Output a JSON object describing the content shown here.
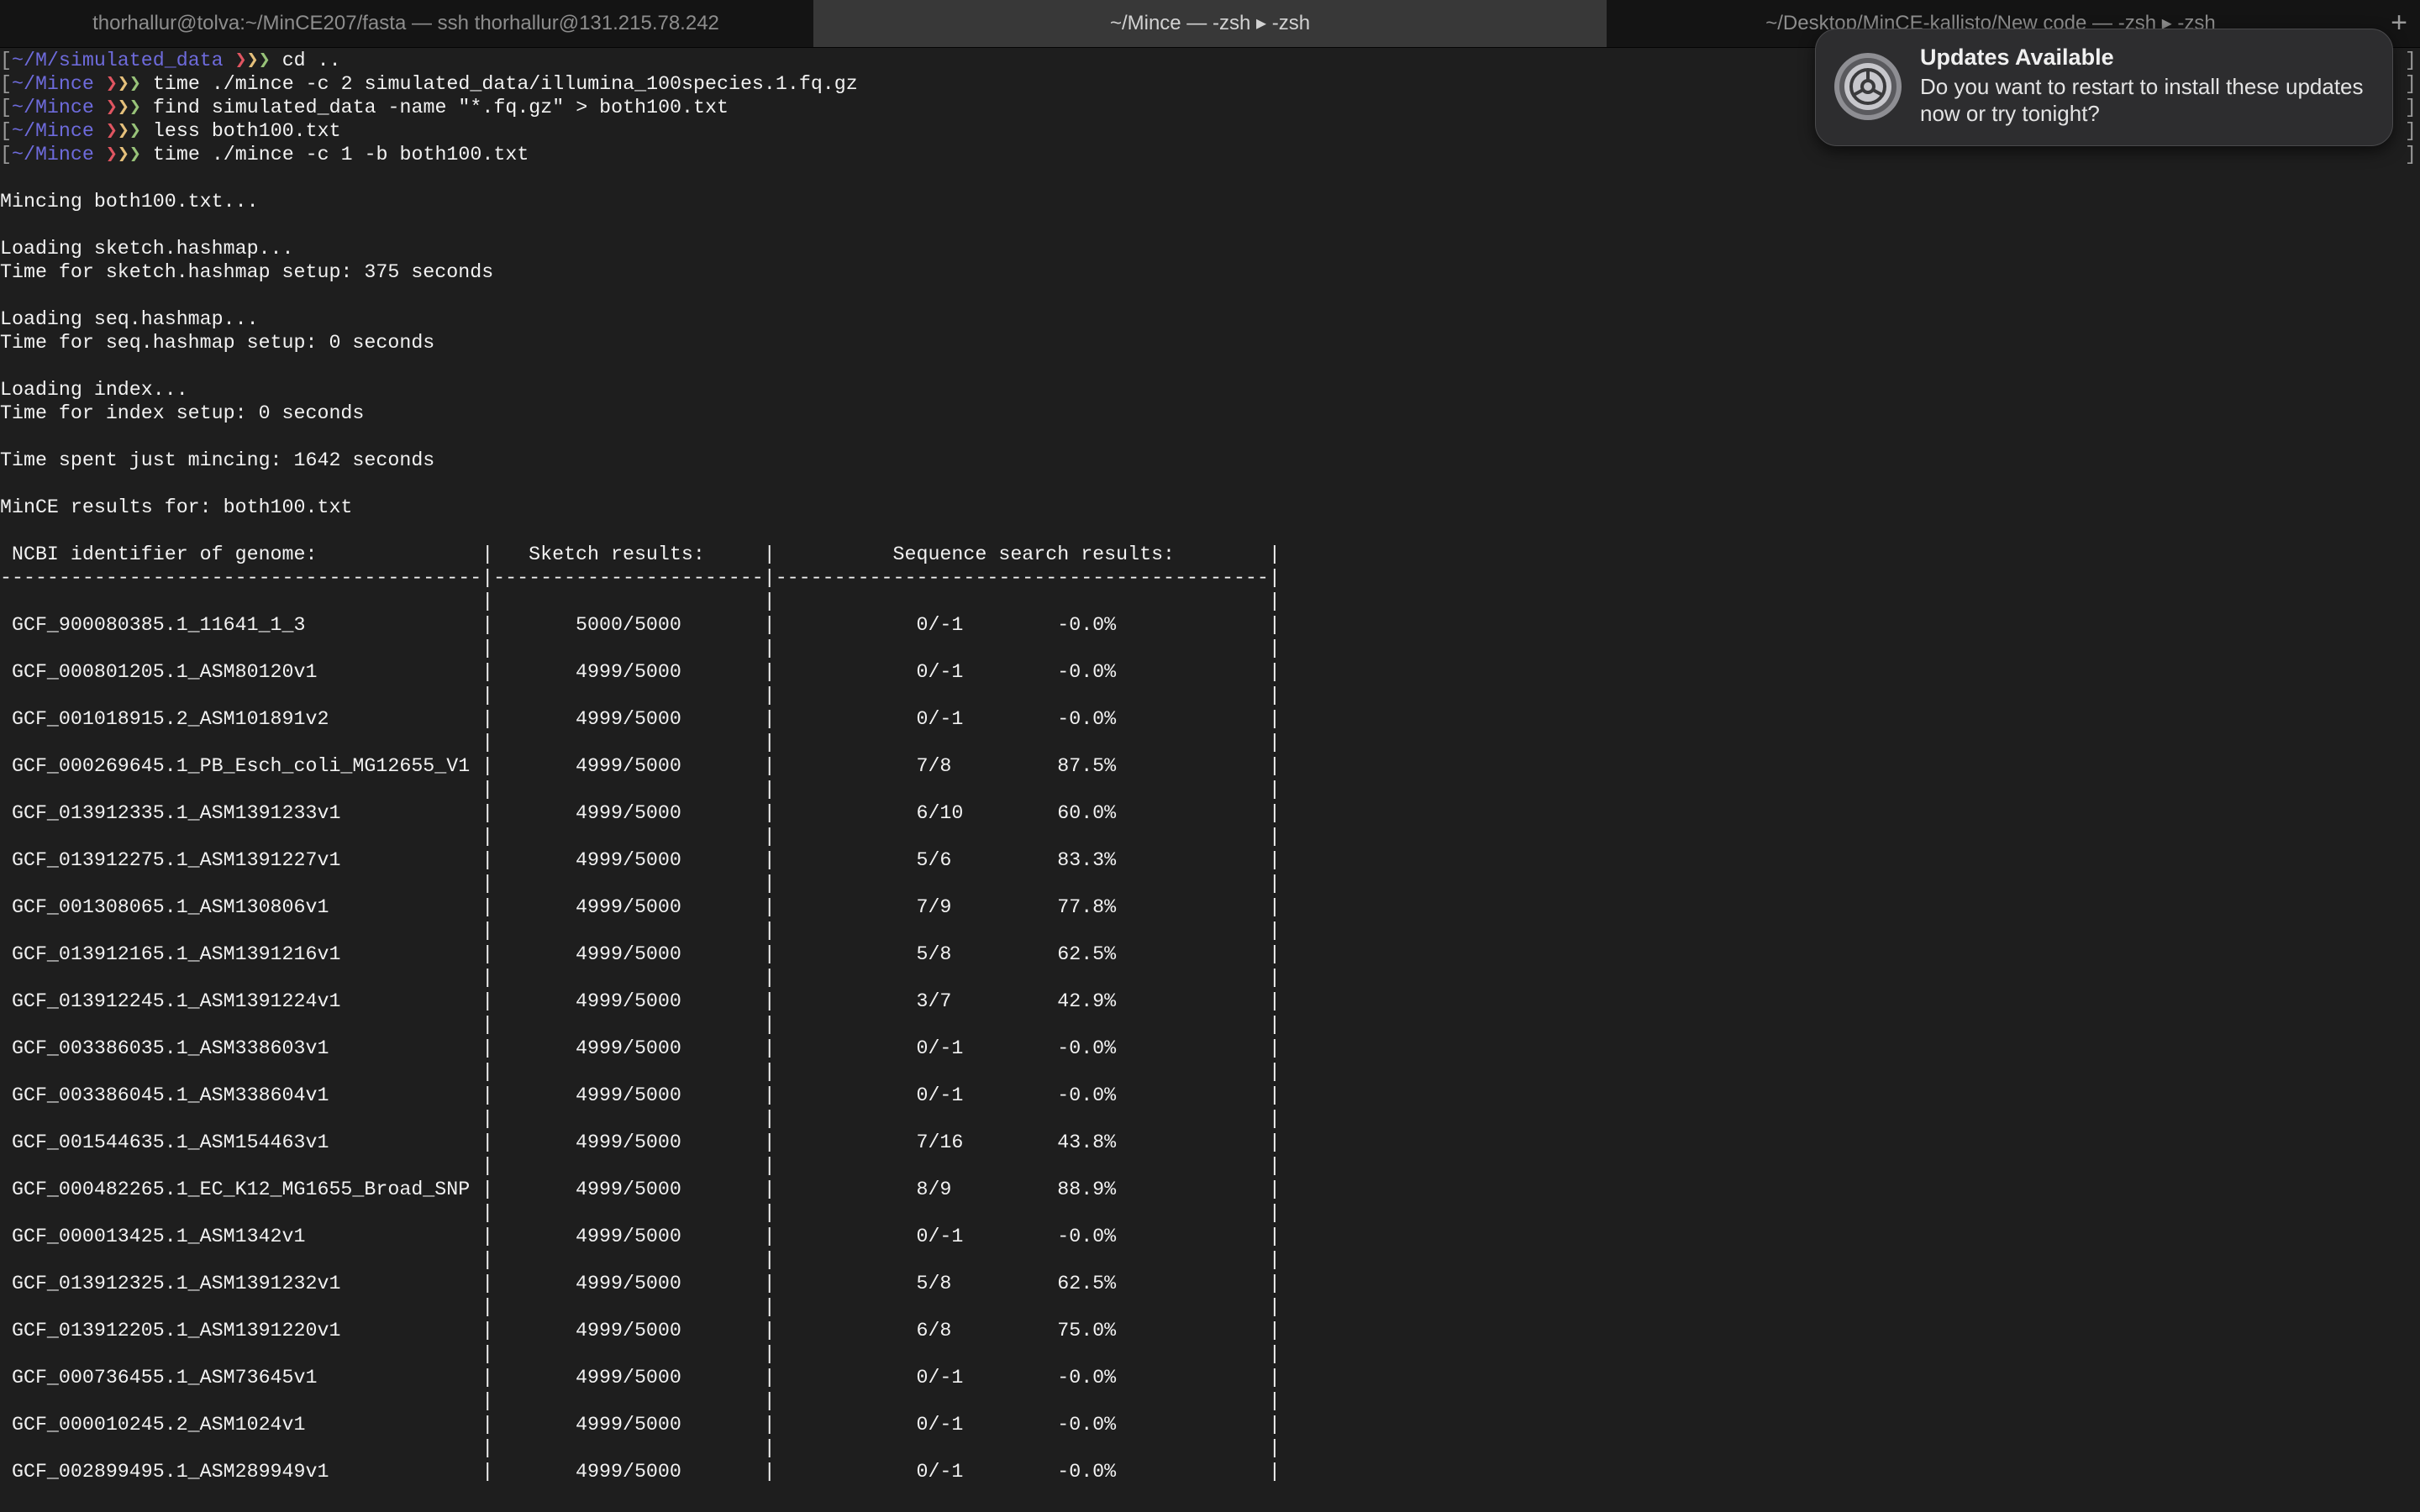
{
  "tabs": [
    {
      "label": "thorhallur@tolva:~/MinCE207/fasta — ssh thorhallur@131.215.78.242",
      "active": false
    },
    {
      "label": "~/Mince — -zsh ▸ -zsh",
      "active": true
    },
    {
      "label": "~/Desktop/MinCE-kallisto/New code — -zsh ▸ -zsh",
      "active": false
    }
  ],
  "new_tab_glyph": "+",
  "prompt": {
    "bracket": "[",
    "arrows": [
      "❯",
      "❯",
      "❯"
    ]
  },
  "commands": [
    {
      "path": "~/M/simulated_data",
      "cmd": "cd .."
    },
    {
      "path": "~/Mince",
      "cmd": "time ./mince -c 2 simulated_data/illumina_100species.1.fq.gz"
    },
    {
      "path": "~/Mince",
      "cmd": "find simulated_data -name \"*.fq.gz\" > both100.txt"
    },
    {
      "path": "~/Mince",
      "cmd": "less both100.txt"
    },
    {
      "path": "~/Mince",
      "cmd": "time ./mince -c 1 -b both100.txt"
    }
  ],
  "output_lines": [
    "",
    "Mincing both100.txt...",
    "",
    "Loading sketch.hashmap...",
    "Time for sketch.hashmap setup: 375 seconds",
    "",
    "Loading seq.hashmap...",
    "Time for seq.hashmap setup: 0 seconds",
    "",
    "Loading index...",
    "Time for index setup: 0 seconds",
    "",
    "Time spent just mincing: 1642 seconds",
    "",
    "MinCE results for: both100.txt",
    ""
  ],
  "table": {
    "headers": {
      "genome": "NCBI identifier of genome:",
      "sketch": "Sketch results:",
      "sequence": "Sequence search results:"
    },
    "rows": [
      {
        "id": "GCF_900080385.1_11641_1_3",
        "sketch": "5000/5000",
        "seq": "0/-1",
        "pct": "-0.0%"
      },
      {
        "id": "GCF_000801205.1_ASM80120v1",
        "sketch": "4999/5000",
        "seq": "0/-1",
        "pct": "-0.0%"
      },
      {
        "id": "GCF_001018915.2_ASM101891v2",
        "sketch": "4999/5000",
        "seq": "0/-1",
        "pct": "-0.0%"
      },
      {
        "id": "GCF_000269645.1_PB_Esch_coli_MG12655_V1",
        "sketch": "4999/5000",
        "seq": "7/8",
        "pct": "87.5%"
      },
      {
        "id": "GCF_013912335.1_ASM1391233v1",
        "sketch": "4999/5000",
        "seq": "6/10",
        "pct": "60.0%"
      },
      {
        "id": "GCF_013912275.1_ASM1391227v1",
        "sketch": "4999/5000",
        "seq": "5/6",
        "pct": "83.3%"
      },
      {
        "id": "GCF_001308065.1_ASM130806v1",
        "sketch": "4999/5000",
        "seq": "7/9",
        "pct": "77.8%"
      },
      {
        "id": "GCF_013912165.1_ASM1391216v1",
        "sketch": "4999/5000",
        "seq": "5/8",
        "pct": "62.5%"
      },
      {
        "id": "GCF_013912245.1_ASM1391224v1",
        "sketch": "4999/5000",
        "seq": "3/7",
        "pct": "42.9%"
      },
      {
        "id": "GCF_003386035.1_ASM338603v1",
        "sketch": "4999/5000",
        "seq": "0/-1",
        "pct": "-0.0%"
      },
      {
        "id": "GCF_003386045.1_ASM338604v1",
        "sketch": "4999/5000",
        "seq": "0/-1",
        "pct": "-0.0%"
      },
      {
        "id": "GCF_001544635.1_ASM154463v1",
        "sketch": "4999/5000",
        "seq": "7/16",
        "pct": "43.8%"
      },
      {
        "id": "GCF_000482265.1_EC_K12_MG1655_Broad_SNP",
        "sketch": "4999/5000",
        "seq": "8/9",
        "pct": "88.9%"
      },
      {
        "id": "GCF_000013425.1_ASM1342v1",
        "sketch": "4999/5000",
        "seq": "0/-1",
        "pct": "-0.0%"
      },
      {
        "id": "GCF_013912325.1_ASM1391232v1",
        "sketch": "4999/5000",
        "seq": "5/8",
        "pct": "62.5%"
      },
      {
        "id": "GCF_013912205.1_ASM1391220v1",
        "sketch": "4999/5000",
        "seq": "6/8",
        "pct": "75.0%"
      },
      {
        "id": "GCF_000736455.1_ASM73645v1",
        "sketch": "4999/5000",
        "seq": "0/-1",
        "pct": "-0.0%"
      },
      {
        "id": "GCF_000010245.2_ASM1024v1",
        "sketch": "4999/5000",
        "seq": "0/-1",
        "pct": "-0.0%"
      },
      {
        "id": "GCF_002899495.1_ASM289949v1",
        "sketch": "4999/5000",
        "seq": "0/-1",
        "pct": "-0.0%"
      }
    ]
  },
  "notification": {
    "title": "Updates Available",
    "body": "Do you want to restart to install these updates now or try tonight?",
    "icon": "system-preferences-gear-icon"
  },
  "colors": {
    "background": "#1e1e1e",
    "path": "#6e6bdc",
    "arrow1": "#e05561",
    "arrow2": "#e5c07b",
    "arrow3": "#98c379"
  }
}
